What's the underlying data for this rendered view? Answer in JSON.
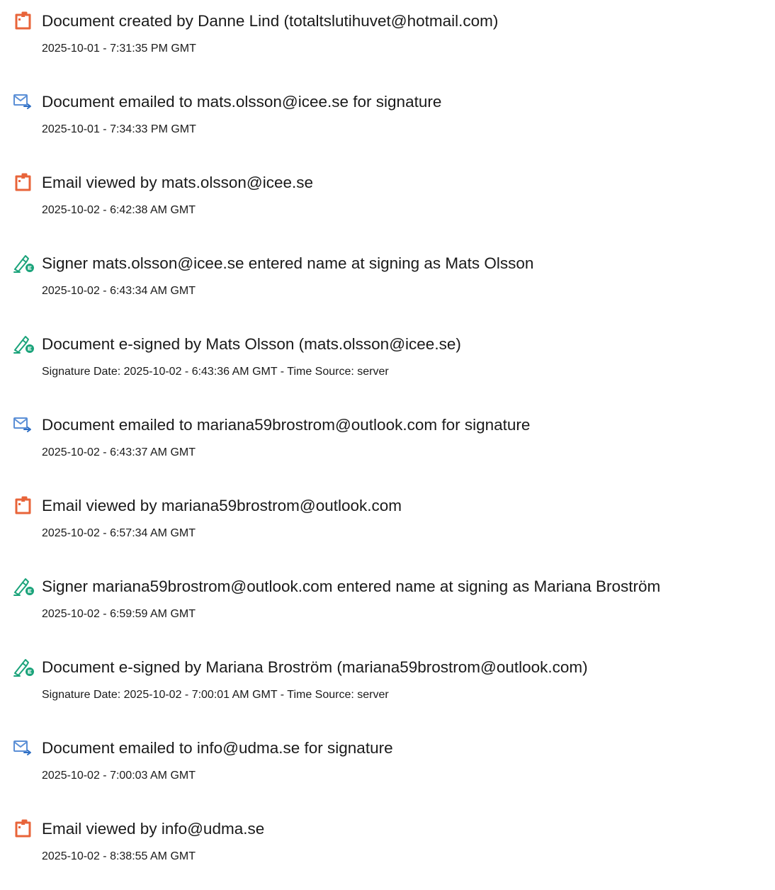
{
  "events": [
    {
      "icon": "document-icon",
      "text": "Document created by Danne Lind (totaltslutihuvet@hotmail.com)",
      "time": "2025-10-01 - 7:31:35 PM GMT"
    },
    {
      "icon": "email-sent-icon",
      "text": "Document emailed to mats.olsson@icee.se for signature",
      "time": "2025-10-01 - 7:34:33 PM GMT"
    },
    {
      "icon": "document-icon",
      "text": "Email viewed by mats.olsson@icee.se",
      "time": "2025-10-02 - 6:42:38 AM GMT"
    },
    {
      "icon": "esign-pen-icon",
      "text": "Signer mats.olsson@icee.se entered name at signing as Mats Olsson",
      "time": "2025-10-02 - 6:43:34 AM GMT"
    },
    {
      "icon": "esign-pen-icon",
      "text": "Document e-signed by Mats Olsson (mats.olsson@icee.se)",
      "time": "Signature Date: 2025-10-02 - 6:43:36 AM GMT - Time Source: server"
    },
    {
      "icon": "email-sent-icon",
      "text": "Document emailed to mariana59brostrom@outlook.com for signature",
      "time": "2025-10-02 - 6:43:37 AM GMT"
    },
    {
      "icon": "document-icon",
      "text": "Email viewed by mariana59brostrom@outlook.com",
      "time": "2025-10-02 - 6:57:34 AM GMT"
    },
    {
      "icon": "esign-pen-icon",
      "text": "Signer mariana59brostrom@outlook.com entered name at signing as Mariana Broström",
      "time": "2025-10-02 - 6:59:59 AM GMT"
    },
    {
      "icon": "esign-pen-icon",
      "text": "Document e-signed by Mariana Broström (mariana59brostrom@outlook.com)",
      "time": "Signature Date: 2025-10-02 - 7:00:01 AM GMT - Time Source: server"
    },
    {
      "icon": "email-sent-icon",
      "text": "Document emailed to info@udma.se for signature",
      "time": "2025-10-02 - 7:00:03 AM GMT"
    },
    {
      "icon": "document-icon",
      "text": "Email viewed by info@udma.se",
      "time": "2025-10-02 - 8:38:55 AM GMT"
    }
  ],
  "colors": {
    "document_icon": "#e8643a",
    "email_icon": "#5b8fd6",
    "esign_icon": "#1aa37a"
  }
}
